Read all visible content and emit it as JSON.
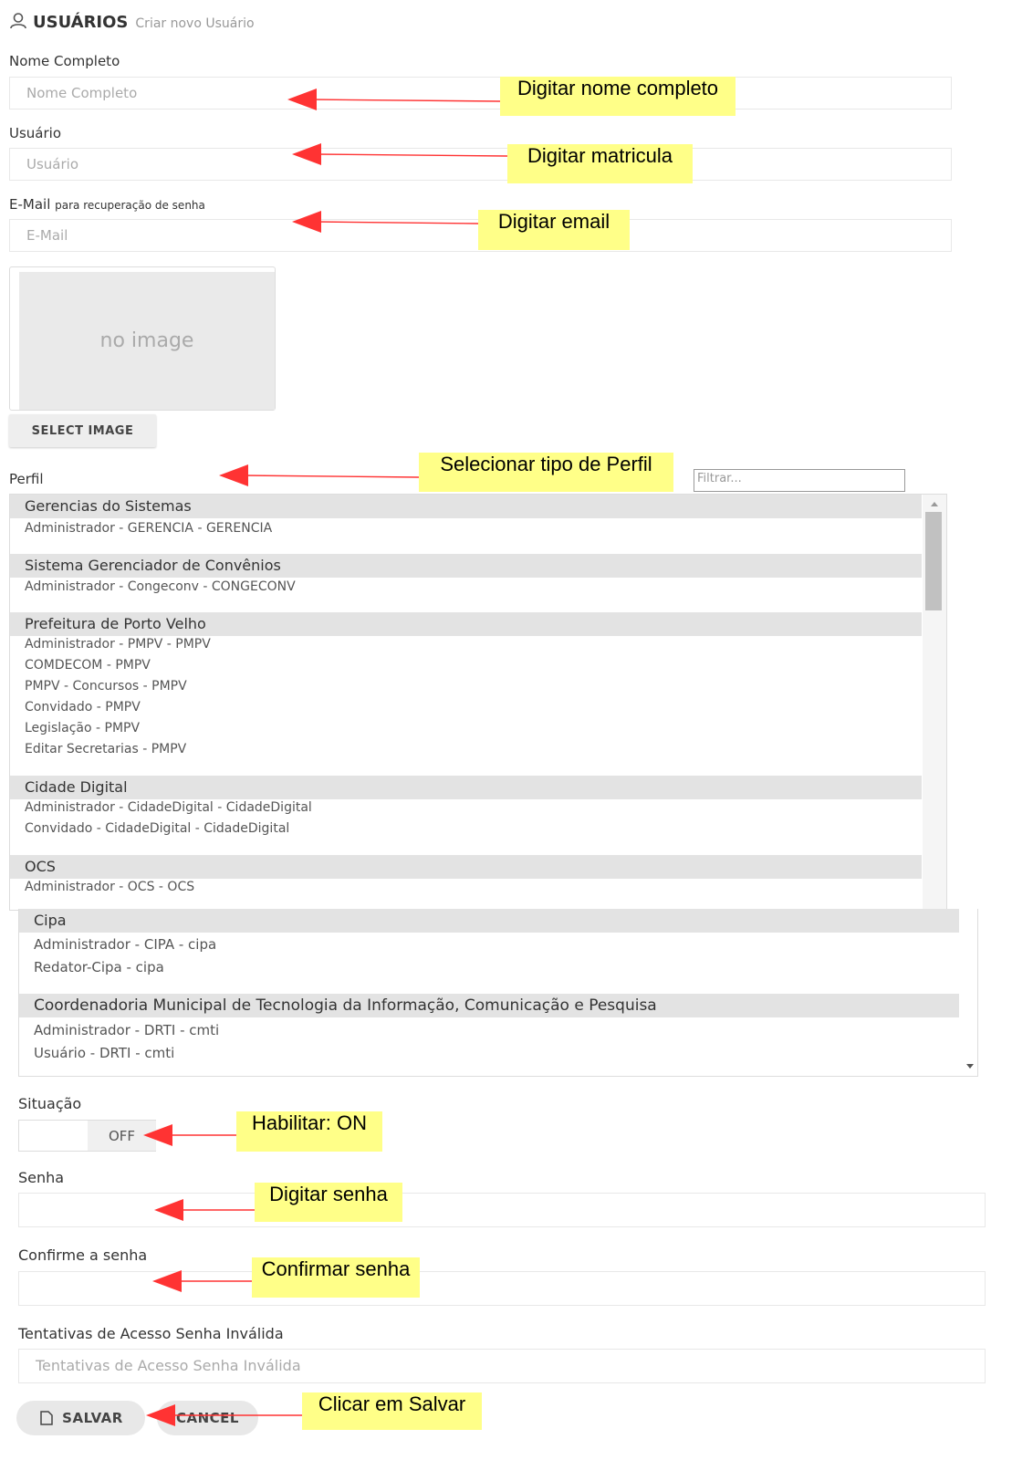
{
  "header": {
    "title": "USUÁRIOS",
    "subtitle": "Criar novo Usuário",
    "icon": "user-icon"
  },
  "form": {
    "nome": {
      "label": "Nome Completo",
      "placeholder": "Nome Completo"
    },
    "usuario": {
      "label": "Usuário",
      "placeholder": "Usuário"
    },
    "email": {
      "label": "E-Mail",
      "hint": "para recuperação de senha",
      "placeholder": "E-Mail"
    },
    "image": {
      "placeholder_text": "no image",
      "button_label": "SELECT IMAGE"
    },
    "perfil": {
      "label": "Perfil",
      "filter_placeholder": "Filtrar...",
      "groups": [
        {
          "name": "Gerencias do Sistemas",
          "options": [
            "Administrador - GERENCIA - GERENCIA"
          ]
        },
        {
          "name": "Sistema Gerenciador de Convênios",
          "options": [
            "Administrador - Congeconv - CONGECONV"
          ]
        },
        {
          "name": "Prefeitura de Porto Velho",
          "options": [
            "Administrador - PMPV - PMPV",
            "COMDECOM - PMPV",
            "PMPV - Concursos - PMPV",
            "Convidado - PMPV",
            "Legislação - PMPV",
            "Editar Secretarias - PMPV"
          ]
        },
        {
          "name": "Cidade Digital",
          "options": [
            "Administrador - CidadeDigital - CidadeDigital",
            "Convidado - CidadeDigital - CidadeDigital"
          ]
        },
        {
          "name": "OCS",
          "options": [
            "Administrador - OCS - OCS"
          ]
        },
        {
          "name": "Cipa",
          "options": [
            "Administrador - CIPA - cipa",
            "Redator-Cipa - cipa"
          ]
        },
        {
          "name": "Coordenadoria Municipal de Tecnologia da Informação, Comunicação e Pesquisa",
          "options": [
            "Administrador - DRTI - cmti",
            "Usuário - DRTI - cmti"
          ]
        }
      ]
    },
    "situacao": {
      "label": "Situação",
      "state": "OFF"
    },
    "senha": {
      "label": "Senha"
    },
    "confirme": {
      "label": "Confirme a senha"
    },
    "tentativas": {
      "label": "Tentativas de Acesso Senha Inválida",
      "placeholder": "Tentativas de Acesso Senha Inválida"
    },
    "buttons": {
      "save": "SALVAR",
      "cancel": "CANCEL"
    }
  },
  "annotations": {
    "nome": "Digitar nome completo",
    "usuario": "Digitar matricula",
    "email": "Digitar email",
    "perfil": "Selecionar tipo de Perfil",
    "situacao": "Habilitar: ON",
    "senha": "Digitar senha",
    "confirme": "Confirmar senha",
    "salvar": "Clicar em Salvar"
  },
  "colors": {
    "note_bg": "#ffff88",
    "arrow": "#ff3333",
    "group_bg": "#e3e3e3"
  }
}
